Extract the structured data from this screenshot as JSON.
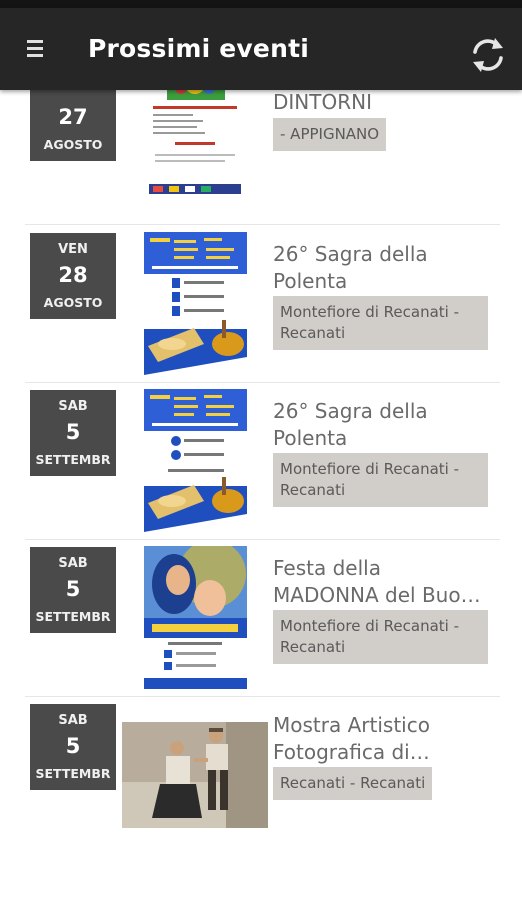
{
  "app": {
    "title": "Prossimi eventi"
  },
  "icons": {
    "menu": "hamburger-menu-icon",
    "refresh": "refresh-icon"
  },
  "colors": {
    "app_bar": "#262626",
    "date_badge": "#4a4a4a",
    "location_tag": "#d1cdc8"
  },
  "events": [
    {
      "day_of_week": "",
      "day": "27",
      "month": "AGOSTO",
      "title": "DINTORNI",
      "location": "- APPIGNANO"
    },
    {
      "day_of_week": "VEN",
      "day": "28",
      "month": "AGOSTO",
      "title": "26° Sagra della Polenta",
      "location": "Montefiore di Recanati - Recanati"
    },
    {
      "day_of_week": "SAB",
      "day": "5",
      "month": "SETTEMBR",
      "title": "26° Sagra della Polenta",
      "location": "Montefiore di Recanati - Recanati"
    },
    {
      "day_of_week": "SAB",
      "day": "5",
      "month": "SETTEMBR",
      "title": "Festa della MADONNA del Buo…",
      "location": "Montefiore di Recanati - Recanati"
    },
    {
      "day_of_week": "SAB",
      "day": "5",
      "month": "SETTEMBR",
      "title": "Mostra Artistico Fotografica di…",
      "location": "Recanati - Recanati"
    }
  ]
}
